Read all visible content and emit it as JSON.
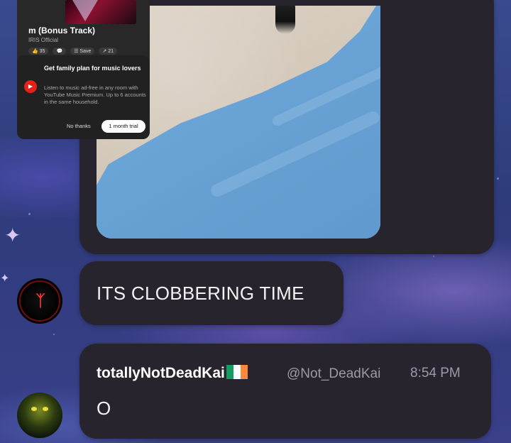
{
  "video_popup": {
    "track_title": "m (Bonus Track)",
    "artist": "IRIS Official",
    "likes": "35",
    "save_label": "Save",
    "shares": "21",
    "premium_title": "Get family plan for music lovers",
    "premium_body": "Listen to music ad-free in any room with YouTube Music Premium. Up to 6 accounts in the same household.",
    "dismiss_label": "No thanks",
    "trial_label": "1 month trial"
  },
  "messages": [
    {
      "text": "ITS CLOBBERING TIME"
    },
    {
      "display_name": "totallyNotDeadKai",
      "handle": "@Not_DeadKai",
      "time": "8:54 PM",
      "text": "O"
    }
  ],
  "colors": {
    "bubble": "#27242e",
    "text": "#f2f2f2",
    "meta": "#9d9aa6",
    "flag_green": "#169b62",
    "flag_white": "#ffffff",
    "flag_orange": "#ff883e"
  },
  "icons": {
    "flag": "ireland-flag-icon",
    "premium": "youtube-music-icon"
  }
}
